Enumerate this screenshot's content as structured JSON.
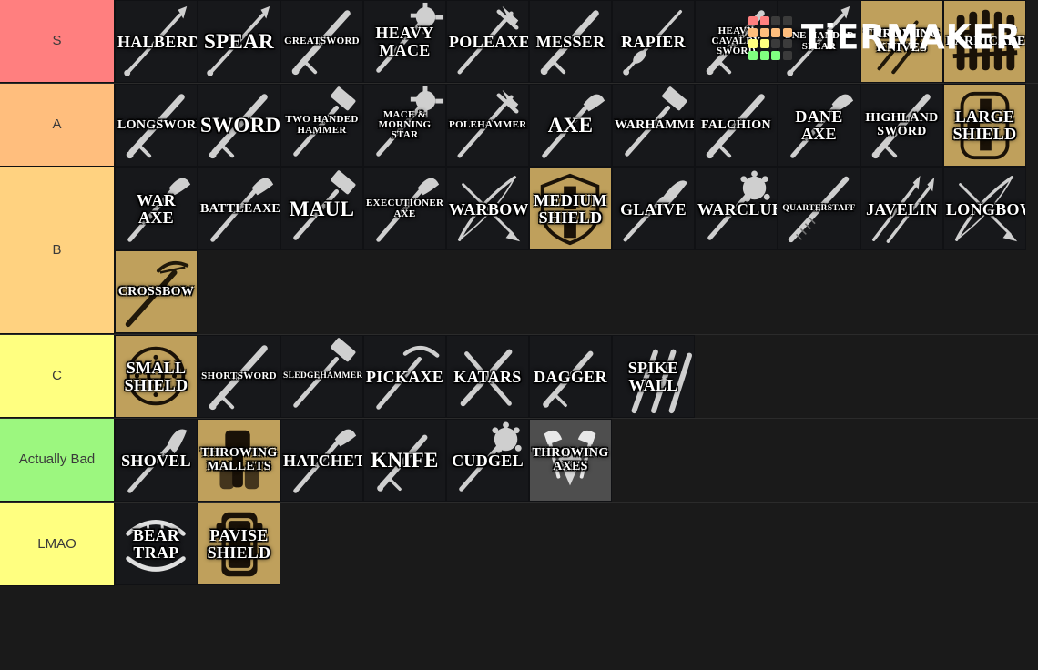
{
  "brand": {
    "name": "TiERMAKER",
    "logo_grid": [
      [
        "#ff8080",
        "#ff8080",
        "#3b3b3b",
        "#3b3b3b"
      ],
      [
        "#ffbe7d",
        "#ffbe7d",
        "#ffbe7d",
        "#ffbe7d"
      ],
      [
        "#ffff80",
        "#ffff80",
        "#3b3b3b",
        "#3b3b3b"
      ],
      [
        "#80ff80",
        "#80ff80",
        "#80ff80",
        "#3b3b3b"
      ]
    ]
  },
  "tiers": [
    {
      "label": "S",
      "color": "#ff7f7f",
      "items": [
        {
          "name": "Halberd",
          "bg": "dark",
          "art": "spear"
        },
        {
          "name": "Spear",
          "bg": "dark",
          "art": "spear"
        },
        {
          "name": "Greatsword",
          "bg": "dark",
          "art": "sword"
        },
        {
          "name": "Heavy Mace",
          "bg": "dark",
          "art": "mace"
        },
        {
          "name": "Poleaxe",
          "bg": "dark",
          "art": "poleaxe"
        },
        {
          "name": "Messer",
          "bg": "dark",
          "art": "sword"
        },
        {
          "name": "Rapier",
          "bg": "dark",
          "art": "rapier"
        },
        {
          "name": "Heavy Cavalry Sword",
          "bg": "dark",
          "art": "sword"
        },
        {
          "name": "One Handed Spear",
          "bg": "dark",
          "art": "spear"
        },
        {
          "name": "Throwing Knives",
          "bg": "gold",
          "art": "knives"
        },
        {
          "name": "Barricade",
          "bg": "gold",
          "art": "barricade"
        }
      ]
    },
    {
      "label": "A",
      "color": "#ffbe7d",
      "items": [
        {
          "name": "Longsword",
          "bg": "dark",
          "art": "sword"
        },
        {
          "name": "Sword",
          "bg": "dark",
          "art": "sword"
        },
        {
          "name": "Two Handed Hammer",
          "bg": "dark",
          "art": "hammer"
        },
        {
          "name": "Mace & Morning Star",
          "bg": "dark",
          "art": "mace"
        },
        {
          "name": "Polehammer",
          "bg": "dark",
          "art": "poleaxe"
        },
        {
          "name": "Axe",
          "bg": "dark",
          "art": "axe"
        },
        {
          "name": "Warhammer",
          "bg": "dark",
          "art": "hammer"
        },
        {
          "name": "Falchion",
          "bg": "dark",
          "art": "sword"
        },
        {
          "name": "Dane Axe",
          "bg": "dark",
          "art": "axe"
        },
        {
          "name": "Highland Sword",
          "bg": "dark",
          "art": "sword"
        },
        {
          "name": "Large Shield",
          "bg": "gold",
          "art": "shield-large"
        }
      ]
    },
    {
      "label": "B",
      "color": "#ffd280",
      "items": [
        {
          "name": "War Axe",
          "bg": "dark",
          "art": "axe"
        },
        {
          "name": "Battleaxe",
          "bg": "dark",
          "art": "axe"
        },
        {
          "name": "Maul",
          "bg": "dark",
          "art": "hammer"
        },
        {
          "name": "Executioner Axe",
          "bg": "dark",
          "art": "axe"
        },
        {
          "name": "Warbow",
          "bg": "dark",
          "art": "bow"
        },
        {
          "name": "Medium Shield",
          "bg": "gold",
          "art": "shield-medium"
        },
        {
          "name": "Glaive",
          "bg": "dark",
          "art": "glaive"
        },
        {
          "name": "Warclub",
          "bg": "dark",
          "art": "club"
        },
        {
          "name": "Quarterstaff",
          "bg": "dark",
          "art": "staff"
        },
        {
          "name": "Javelin",
          "bg": "dark",
          "art": "javelin"
        },
        {
          "name": "Longbow",
          "bg": "dark",
          "art": "bow"
        },
        {
          "name": "Crossbow",
          "bg": "gold",
          "art": "crossbow"
        }
      ]
    },
    {
      "label": "C",
      "color": "#ffff80",
      "items": [
        {
          "name": "Small Shield",
          "bg": "gold",
          "art": "shield-small"
        },
        {
          "name": "Shortsword",
          "bg": "dark",
          "art": "sword"
        },
        {
          "name": "Sledgehammer",
          "bg": "dark",
          "art": "hammer"
        },
        {
          "name": "Pickaxe",
          "bg": "dark",
          "art": "pickaxe"
        },
        {
          "name": "Katars",
          "bg": "dark",
          "art": "katars"
        },
        {
          "name": "Dagger",
          "bg": "dark",
          "art": "dagger"
        },
        {
          "name": "Spike Wall",
          "bg": "dark",
          "art": "spikewall"
        }
      ]
    },
    {
      "label": "Actually Bad",
      "color": "#9cf77f",
      "items": [
        {
          "name": "Shovel",
          "bg": "dark",
          "art": "shovel"
        },
        {
          "name": "Throwing Mallets",
          "bg": "gold",
          "art": "mallets"
        },
        {
          "name": "Hatchet",
          "bg": "dark",
          "art": "axe"
        },
        {
          "name": "Knife",
          "bg": "dark",
          "art": "dagger"
        },
        {
          "name": "Cudgel",
          "bg": "dark",
          "art": "club"
        },
        {
          "name": "Throwing Axes",
          "bg": "gray",
          "art": "throwing-axes"
        }
      ]
    },
    {
      "label": "LMAO",
      "color": "#ffff80",
      "items": [
        {
          "name": "Bear Trap",
          "bg": "dark",
          "art": "beartrap"
        },
        {
          "name": "Pavise Shield",
          "bg": "gold",
          "art": "pavise"
        }
      ]
    }
  ]
}
